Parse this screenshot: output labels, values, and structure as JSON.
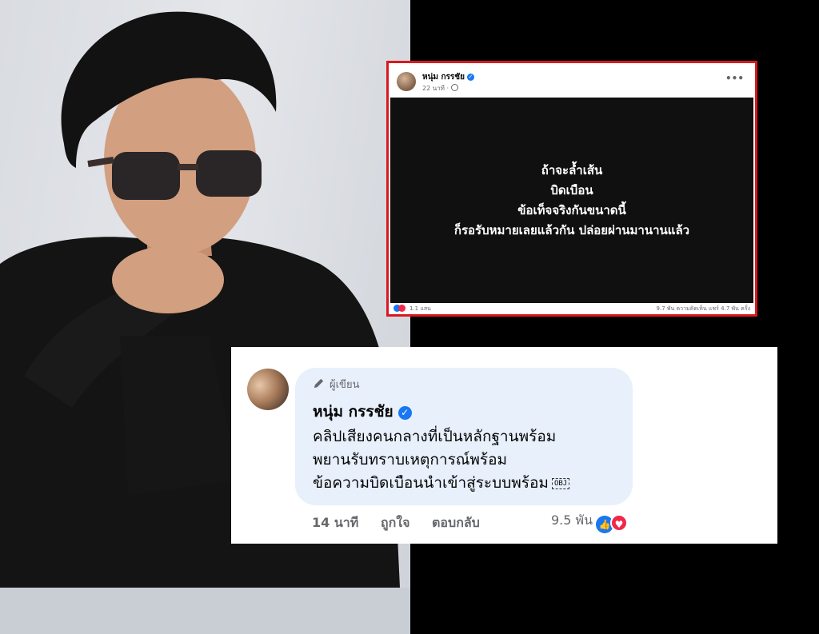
{
  "post": {
    "author": "หนุ่ม กรรชัย",
    "time": "22 นาที ·",
    "lines": [
      "ถ้าจะล้ำเส้น",
      "บิดเบือน",
      "ข้อเท็จจริงกันขนาดนี้",
      "ก็รอรับหมายเลยแล้วกัน ปล่อยผ่านมานานแล้ว"
    ],
    "reaction_count": "1.1 แสน",
    "stats": "9.7 พัน ความคิดเห็น   แชร์ 4.7 พัน ครั้ง"
  },
  "comment": {
    "badge": "ผู้เขียน",
    "author": "หนุ่ม กรรชัย",
    "lines": [
      "คลิปเสียงคนกลางที่เป็นหลักฐานพร้อม",
      "พยานรับทราบเหตุการณ์พร้อม",
      "ข้อความบิดเบือนนำเข้าสู่ระบบพร้อม"
    ],
    "obj_glyph": "OBJ",
    "time": "14 นาที",
    "like_label": "ถูกใจ",
    "reply_label": "ตอบกลับ",
    "reaction_count": "9.5 พัน"
  },
  "colors": {
    "verified": "#1877f2",
    "highlight_border": "#d8191f",
    "love": "#f02849",
    "bubble": "#e8f0fc"
  }
}
